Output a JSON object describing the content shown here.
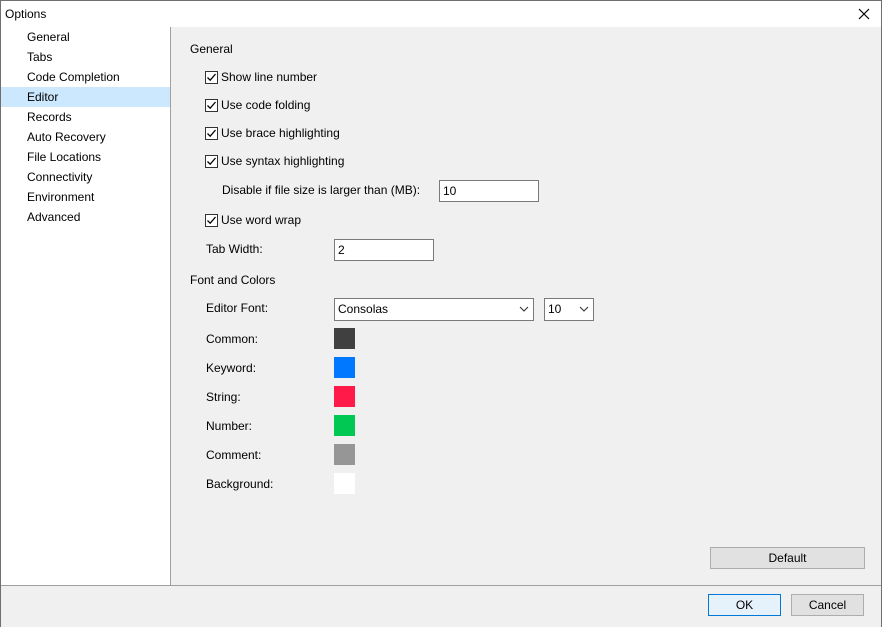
{
  "window": {
    "title": "Options"
  },
  "sidebar": {
    "items": [
      {
        "label": "General"
      },
      {
        "label": "Tabs"
      },
      {
        "label": "Code Completion"
      },
      {
        "label": "Editor"
      },
      {
        "label": "Records"
      },
      {
        "label": "Auto Recovery"
      },
      {
        "label": "File Locations"
      },
      {
        "label": "Connectivity"
      },
      {
        "label": "Environment"
      },
      {
        "label": "Advanced"
      }
    ],
    "selected": "Editor"
  },
  "general": {
    "heading": "General",
    "show_line_number": {
      "label": "Show line number",
      "checked": true
    },
    "code_folding": {
      "label": "Use code folding",
      "checked": true
    },
    "brace_highlighting": {
      "label": "Use brace highlighting",
      "checked": true
    },
    "syntax_highlighting": {
      "label": "Use syntax highlighting",
      "checked": true
    },
    "disable_size": {
      "label": "Disable if file size is larger than (MB):",
      "value": "10"
    },
    "word_wrap": {
      "label": "Use word wrap",
      "checked": true
    },
    "tab_width": {
      "label": "Tab Width:",
      "value": "2"
    }
  },
  "font_colors": {
    "heading": "Font and Colors",
    "editor_font": {
      "label": "Editor Font:",
      "font": "Consolas",
      "size": "10"
    },
    "colors": [
      {
        "label": "Common:",
        "color": "#404040"
      },
      {
        "label": "Keyword:",
        "color": "#0078ff"
      },
      {
        "label": "String:",
        "color": "#ff1a4a"
      },
      {
        "label": "Number:",
        "color": "#00c853"
      },
      {
        "label": "Comment:",
        "color": "#969696"
      },
      {
        "label": "Background:",
        "color": "#ffffff"
      }
    ]
  },
  "buttons": {
    "default": "Default",
    "ok": "OK",
    "cancel": "Cancel"
  },
  "icons": {
    "close": "close-icon",
    "checkmark": "checkmark-icon",
    "dropdown": "chevron-down-icon"
  }
}
